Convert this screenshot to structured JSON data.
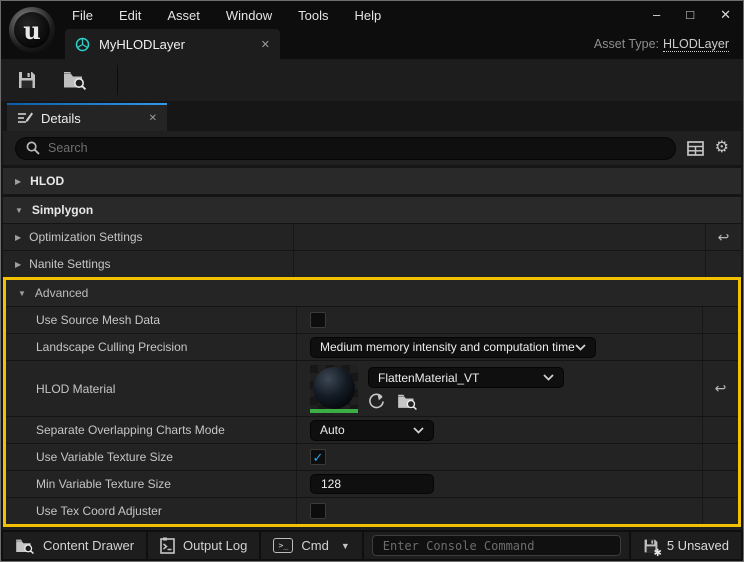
{
  "window": {
    "menu": [
      "File",
      "Edit",
      "Asset",
      "Window",
      "Tools",
      "Help"
    ],
    "asset_tab_label": "MyHLODLayer",
    "asset_type_label": "Asset Type:",
    "asset_type_value": "HLODLayer",
    "controls": {
      "minimize": "–",
      "maximize": "□",
      "close": "✕"
    },
    "tab_close": "✕"
  },
  "details_panel": {
    "tab_label": "Details",
    "tab_close": "✕",
    "search_placeholder": "Search",
    "category_hlod": "HLOD",
    "category_simplygon": "Simplygon",
    "row_optimization_settings": "Optimization Settings",
    "row_nanite_settings": "Nanite Settings",
    "category_advanced": "Advanced",
    "advanced": {
      "use_source_mesh_data": {
        "label": "Use Source Mesh Data",
        "checked": false
      },
      "landscape_culling_precision": {
        "label": "Landscape Culling Precision",
        "value": "Medium memory intensity and computation time"
      },
      "hlod_material": {
        "label": "HLOD Material",
        "value": "FlattenMaterial_VT"
      },
      "separate_overlapping_charts_mode": {
        "label": "Separate Overlapping Charts Mode",
        "value": "Auto"
      },
      "use_variable_texture_size": {
        "label": "Use Variable Texture Size",
        "checked": true,
        "check_glyph": "✓"
      },
      "min_variable_texture_size": {
        "label": "Min Variable Texture Size",
        "value": "128"
      },
      "use_tex_coord_adjuster": {
        "label": "Use Tex Coord Adjuster",
        "checked": false
      }
    }
  },
  "status_bar": {
    "content_drawer_label": "Content Drawer",
    "output_log_label": "Output Log",
    "cmd_label": "Cmd",
    "console_placeholder": "Enter Console Command",
    "unsaved_label": "5 Unsaved"
  },
  "colors": {
    "highlight_yellow": "#F2C100",
    "details_tab_accent": "#1F7AD4",
    "checkbox_check_blue": "#2AA6F2",
    "material_underline_green": "#3BAE45",
    "hlod_icon_teal": "#2AD1C8"
  }
}
